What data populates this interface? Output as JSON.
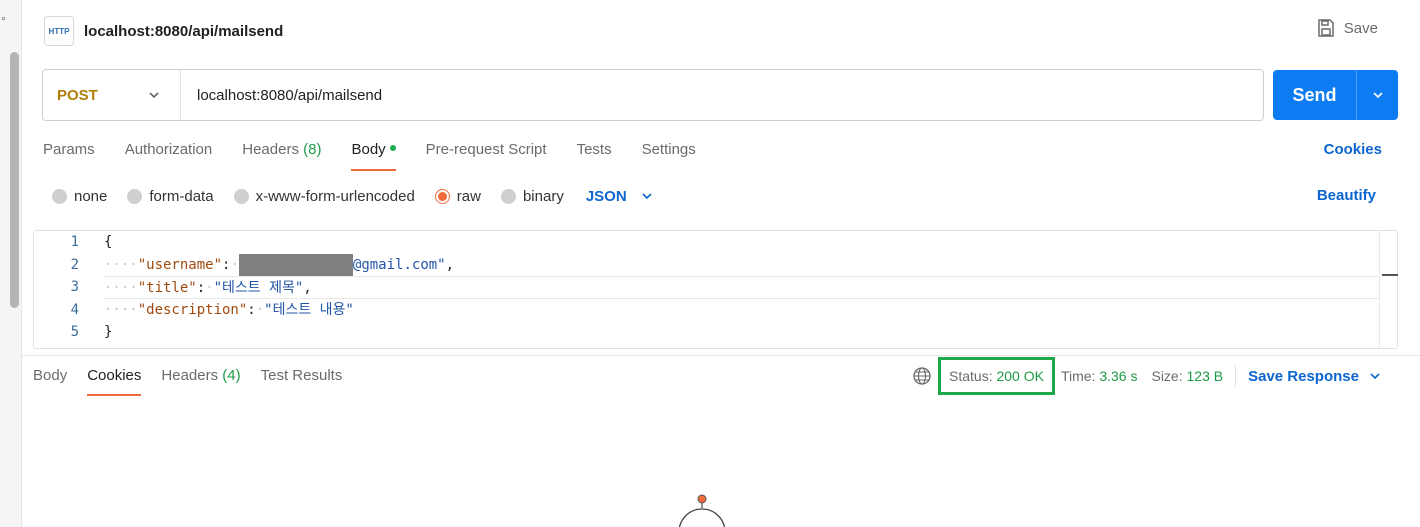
{
  "request": {
    "title": "localhost:8080/api/mailsend",
    "icon_label": "HTTP",
    "save_label": "Save",
    "method": "POST",
    "url": "localhost:8080/api/mailsend",
    "send_label": "Send"
  },
  "req_tabs": [
    {
      "label": "Params"
    },
    {
      "label": "Authorization"
    },
    {
      "label": "Headers",
      "count": "(8)"
    },
    {
      "label": "Body",
      "active": true
    },
    {
      "label": "Pre-request Script"
    },
    {
      "label": "Tests"
    },
    {
      "label": "Settings"
    }
  ],
  "cookies_link": "Cookies",
  "body_types": {
    "none": "none",
    "form_data": "form-data",
    "urlencoded": "x-www-form-urlencoded",
    "raw": "raw",
    "binary": "binary",
    "format": "JSON",
    "selected": "raw"
  },
  "beautify_label": "Beautify",
  "editor": {
    "line_numbers": [
      "1",
      "2",
      "3",
      "4",
      "5"
    ],
    "open_brace": "{",
    "close_brace": "}",
    "username_key": "\"username\"",
    "username_suffix": "@gmail.com\"",
    "title_key": "\"title\"",
    "title_value": "\"테스트 제목\"",
    "description_key": "\"description\"",
    "description_value": "\"테스트 내용\""
  },
  "response": {
    "tabs": [
      {
        "label": "Body"
      },
      {
        "label": "Cookies",
        "active": true
      },
      {
        "label": "Headers",
        "count": "(4)"
      },
      {
        "label": "Test Results"
      }
    ],
    "status_label": "Status:",
    "status_value": "200 OK",
    "time_label": "Time:",
    "time_value": "3.36 s",
    "size_label": "Size:",
    "size_value": "123 B",
    "save_response_label": "Save Response"
  },
  "colors": {
    "accent_blue": "#0d7cf2",
    "method_post": "#b07d08",
    "status_green": "#1e9b47",
    "highlight_box": "#1ea84a",
    "active_tab": "#f26b3a"
  }
}
